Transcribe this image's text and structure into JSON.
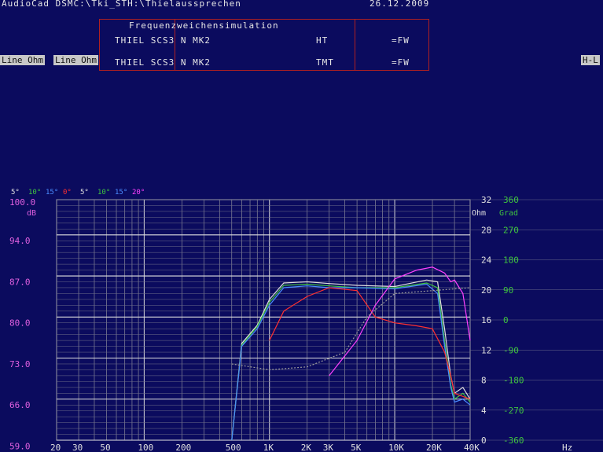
{
  "app": {
    "title_left": "AudioCad DSMC:\\Tki_STH:\\Thielaussprechen",
    "title_right": "26.12.2009"
  },
  "panel": {
    "title": "Frequenzweichensimulation",
    "row1_name": "THIEL SCS3 N MK2",
    "row1_flag": "HT",
    "row1_unit": "=FW",
    "row2_name": "THIEL SCS3 N MK2",
    "row2_flag": "TMT",
    "row2_unit": "=FW"
  },
  "tabs": {
    "left1": "Line Ohm",
    "left2": "Line Ohm",
    "right": "H-L"
  },
  "legend": {
    "angles": [
      "5°",
      "10°",
      "15°",
      "0°",
      "5°",
      "10°",
      "15°",
      "20°"
    ],
    "colors": [
      "#e0e0e0",
      "#3fc43f",
      "#4a8cff",
      "#ff3030",
      "#e0e0e0",
      "#3fc43f",
      "#4a8cff",
      "#ff40ff"
    ]
  },
  "axis_labels": {
    "db": "dB",
    "ohm": "Ohm",
    "grad": "Grad",
    "hz": "Hz"
  },
  "chart_data": {
    "type": "line",
    "title": "Frequenzweichensimulation",
    "xlabel": "Hz",
    "ylabel": "dB",
    "x_scale": "log",
    "xlim": [
      20,
      40000
    ],
    "ylim": [
      59,
      100
    ],
    "x_ticks": [
      "20",
      "30",
      "50",
      "100",
      "200",
      "500",
      "1K",
      "2K",
      "3K",
      "5K",
      "10K",
      "20K",
      "40K"
    ],
    "y_ticks_db": [
      "100.0",
      "94.0",
      "87.0",
      "80.0",
      "73.0",
      "66.0",
      "59.0"
    ],
    "y_ticks_ohm": [
      "32",
      "28",
      "24",
      "20",
      "16",
      "12",
      "8",
      "4",
      "0"
    ],
    "y_ticks_grad": [
      "360",
      "270",
      "180",
      "90",
      "0",
      "-90",
      "-180",
      "-270",
      "-360"
    ],
    "grid": true,
    "series": [
      {
        "name": "0°",
        "color": "#e0e0e0",
        "points": [
          [
            500,
            59
          ],
          [
            600,
            75.5
          ],
          [
            800,
            78.6
          ],
          [
            1000,
            83
          ],
          [
            1300,
            85.8
          ],
          [
            2000,
            86
          ],
          [
            3000,
            85.7
          ],
          [
            5000,
            85.4
          ],
          [
            10000,
            85.2
          ],
          [
            18000,
            86.3
          ],
          [
            22000,
            86
          ],
          [
            25000,
            78
          ],
          [
            28000,
            70
          ],
          [
            30000,
            67
          ],
          [
            35000,
            68
          ],
          [
            40000,
            66
          ]
        ]
      },
      {
        "name": "5°",
        "color": "#3fc43f",
        "points": [
          [
            500,
            59
          ],
          [
            600,
            75.2
          ],
          [
            800,
            78.4
          ],
          [
            1000,
            82.5
          ],
          [
            1300,
            85.4
          ],
          [
            2000,
            85.6
          ],
          [
            3000,
            85.3
          ],
          [
            5000,
            85
          ],
          [
            10000,
            85
          ],
          [
            18000,
            85.8
          ],
          [
            22000,
            85
          ],
          [
            25000,
            76
          ],
          [
            28000,
            68.5
          ],
          [
            30000,
            66
          ],
          [
            35000,
            67
          ],
          [
            40000,
            65.5
          ]
        ]
      },
      {
        "name": "10°",
        "color": "#4a8cff",
        "points": [
          [
            500,
            59
          ],
          [
            600,
            75
          ],
          [
            800,
            78
          ],
          [
            1000,
            82
          ],
          [
            1300,
            85
          ],
          [
            2000,
            85.3
          ],
          [
            3000,
            85
          ],
          [
            5000,
            85
          ],
          [
            10000,
            84.8
          ],
          [
            18000,
            85.6
          ],
          [
            22000,
            84
          ],
          [
            25000,
            75
          ],
          [
            28000,
            68
          ],
          [
            30000,
            65.5
          ],
          [
            35000,
            66
          ],
          [
            40000,
            65
          ]
        ]
      },
      {
        "name": "15°",
        "color": "#ff3030",
        "points": [
          [
            1000,
            76
          ],
          [
            1300,
            81
          ],
          [
            2000,
            83.5
          ],
          [
            3000,
            85
          ],
          [
            5000,
            84.5
          ],
          [
            7000,
            80
          ],
          [
            10000,
            79
          ],
          [
            15000,
            78.5
          ],
          [
            20000,
            78
          ],
          [
            25000,
            74
          ],
          [
            28000,
            70
          ],
          [
            30000,
            67
          ],
          [
            40000,
            66
          ]
        ]
      },
      {
        "name": "20°",
        "color": "#ff40ff",
        "points": [
          [
            3000,
            70
          ],
          [
            5000,
            76
          ],
          [
            7000,
            82
          ],
          [
            10000,
            86.5
          ],
          [
            15000,
            88
          ],
          [
            20000,
            88.5
          ],
          [
            25000,
            87.5
          ],
          [
            28000,
            86
          ],
          [
            30000,
            86.3
          ],
          [
            35000,
            84
          ],
          [
            40000,
            76
          ]
        ]
      },
      {
        "name": "impedance",
        "color": "#9c9c9c",
        "points": [
          [
            500,
            72
          ],
          [
            1000,
            71
          ],
          [
            2000,
            71.5
          ],
          [
            4000,
            74
          ],
          [
            6000,
            80
          ],
          [
            10000,
            84
          ],
          [
            20000,
            84.5
          ],
          [
            40000,
            85
          ]
        ]
      }
    ]
  }
}
